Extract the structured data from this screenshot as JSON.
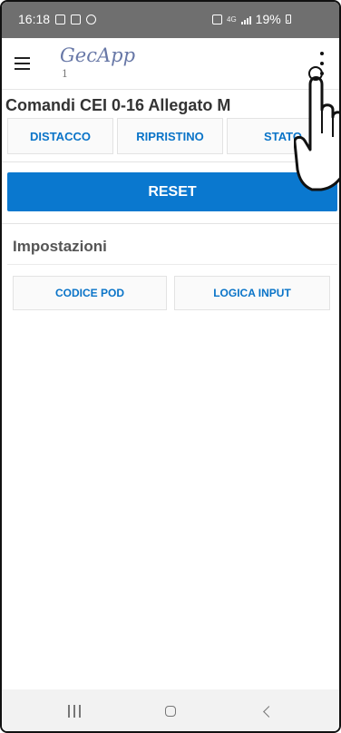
{
  "status_bar": {
    "time": "16:18",
    "network": "4G",
    "battery": "19%"
  },
  "app_bar": {
    "title": "GecApp",
    "subtitle": "1"
  },
  "commands": {
    "title": "Comandi CEI 0-16 Allegato M",
    "buttons": [
      "DISTACCO",
      "RIPRISTINO",
      "STATO"
    ],
    "reset_label": "RESET"
  },
  "settings": {
    "title": "Impostazioni",
    "buttons": [
      "CODICE POD",
      "LOGICA INPUT"
    ]
  },
  "colors": {
    "accent": "#0a78cf",
    "app_title": "#6878a7"
  }
}
